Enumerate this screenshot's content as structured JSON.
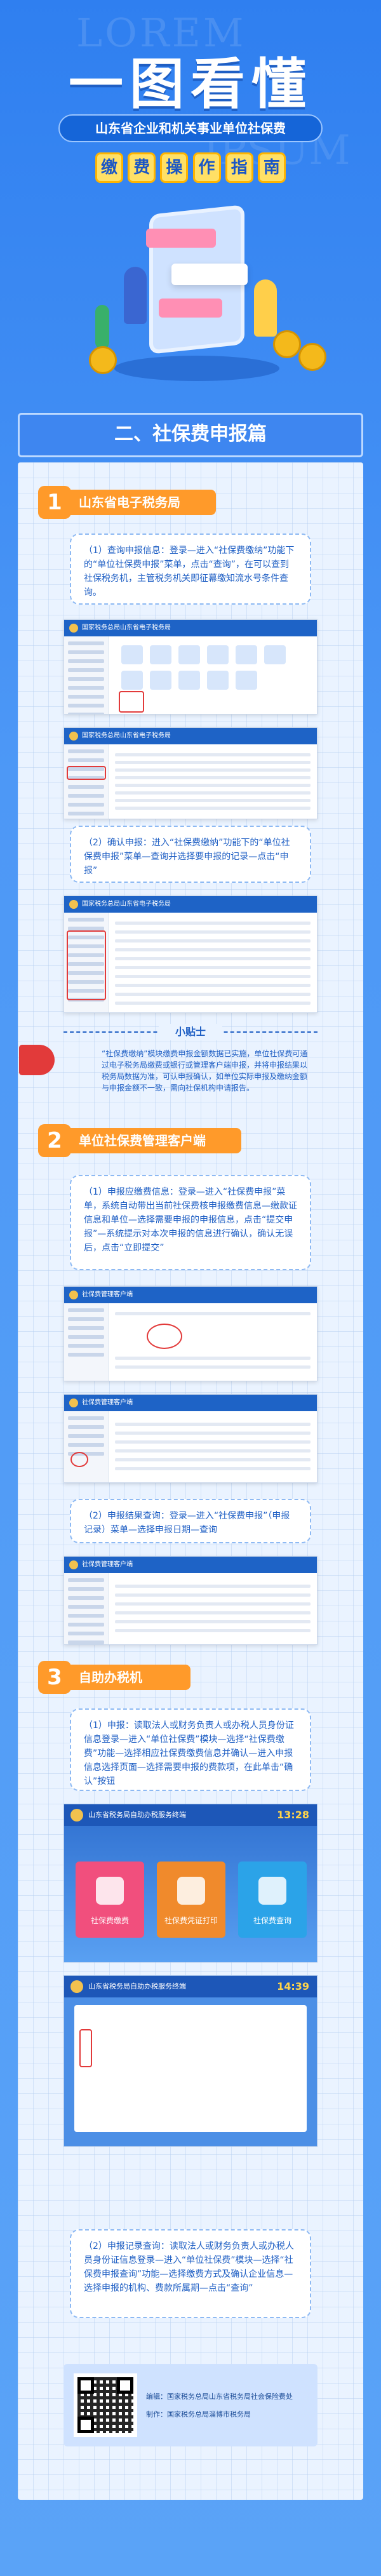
{
  "hero": {
    "watermark_top": "LOREM",
    "watermark_mid": "IPSUM",
    "title": "一图看懂",
    "subtitle": "山东省企业和机关事业单位社保费",
    "title_chars": [
      "缴",
      "费",
      "操",
      "作",
      "指",
      "南"
    ]
  },
  "banner": {
    "title": "二、社保费申报篇"
  },
  "sections": [
    {
      "num": "1",
      "label": "山东省电子税务局"
    },
    {
      "num": "2",
      "label": "单位社保费管理客户端"
    },
    {
      "num": "3",
      "label": "自助办税机"
    }
  ],
  "notes": {
    "s1_query": "（1）查询申报信息：登录—进入“社保费缴纳”功能下的“单位社保费申报”菜单，点击“查询”，在可以查到社保税务机，主管税务机关即征幕缴知流水号条件查询。",
    "s1_confirm": "（2）确认申报：进入“社保费缴纳”功能下的“单位社保费申报”菜单—查询并选择要申报的记录—点击“申报”",
    "s2_query": "（1）申报应缴费信息：登录—进入“社保费申报”菜单，系统自动带出当前社保费核申报缴费信息—缴款证信息和单位—选择需要申报的申报信息，点击“提交申报”—系统提示对本次申报的信息进行确认，确认无误后，点击“立即提交”",
    "s2_record": "（2）申报结果查询：登录—进入“社保费申报”（申报记录）菜单—选择申报日期—查询",
    "s3_report": "（1）申报：读取法人或财务负责人或办税人员身份证信息登录—进入“单位社保费”模块—选择“社保费缴费”功能—选择相应社保费缴费信息并确认—进入申报信息选择页面—选择需要申报的费款项，在此单击“确认”按钮",
    "s3_record": "（2）申报记录查询：读取法人或财务负责人或办税人员身份证信息登录—进入“单位社保费”模块—选择“社保费申报查询”功能—选择缴费方式及确认企业信息—选择申报的机构、费款所属期—点击“查询”"
  },
  "tips": {
    "label": "小贴士",
    "text": "“社保费缴纳”模块缴费申报金额数据已实施，单位社保费可通过电子税务局缴费或银行或管理客户端申报，并将申报结果以税务局数据为准，可认申报确认，如单位实际申报及缴纳金额与申报金额不一致，需向社保机构申请报告。"
  },
  "shots": {
    "s1_top_title": "国家税务总局山东省电子税务局",
    "s1_mid_title": "国家税务总局山东省电子税务局",
    "s1_low_title": "国家税务总局山东省电子税务局",
    "s2_titles": [
      "社保费管理客户端",
      "社保费管理客户端",
      "社保费管理客户端"
    ],
    "kiosk_title": "山东省税务局自助办税服务终端",
    "kiosk_time": "13:28",
    "kiosk_tiles": [
      "社保费缴费",
      "社保费凭证打印",
      "社保费查询"
    ],
    "kiosk2_time": "14:39"
  },
  "footer": {
    "lines": [
      "编辑：国家税务总局山东省税务局社会保险费处",
      "制作：国家税务总局淄博市税务局"
    ]
  },
  "colors": {
    "accent": "#ff9a2a",
    "primary": "#1f5fc4",
    "paper": "#eaf3ff"
  }
}
